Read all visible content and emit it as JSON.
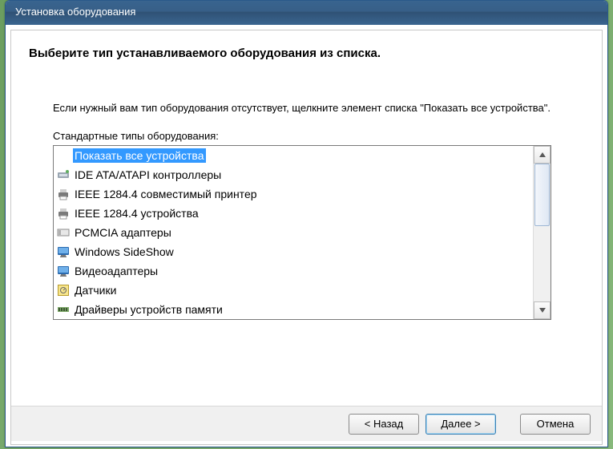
{
  "window": {
    "title": "Установка оборудования"
  },
  "header": {
    "text": "Выберите тип устанавливаемого оборудования из списка."
  },
  "body": {
    "hint": "Если нужный вам тип оборудования отсутствует, щелкните элемент списка \"Показать все устройства\".",
    "list_label": "Стандартные типы оборудования:"
  },
  "list": {
    "items": [
      {
        "label": "Показать все устройства",
        "icon": "blank",
        "selected": true
      },
      {
        "label": "IDE ATA/ATAPI контроллеры",
        "icon": "controller",
        "selected": false
      },
      {
        "label": "IEEE 1284.4 совместимый принтер",
        "icon": "printer",
        "selected": false
      },
      {
        "label": "IEEE 1284.4 устройства",
        "icon": "printer",
        "selected": false
      },
      {
        "label": "PCMCIA адаптеры",
        "icon": "card",
        "selected": false
      },
      {
        "label": "Windows SideShow",
        "icon": "display",
        "selected": false
      },
      {
        "label": "Видеоадаптеры",
        "icon": "display",
        "selected": false
      },
      {
        "label": "Датчики",
        "icon": "sensor",
        "selected": false
      },
      {
        "label": "Драйверы устройств памяти",
        "icon": "memory",
        "selected": false
      }
    ]
  },
  "buttons": {
    "back": "< Назад",
    "next": "Далее >",
    "cancel": "Отмена"
  },
  "icons": {
    "blank": "",
    "controller": "ide",
    "printer": "printer",
    "card": "pcmcia",
    "display": "display",
    "sensor": "sensor",
    "memory": "memory"
  }
}
